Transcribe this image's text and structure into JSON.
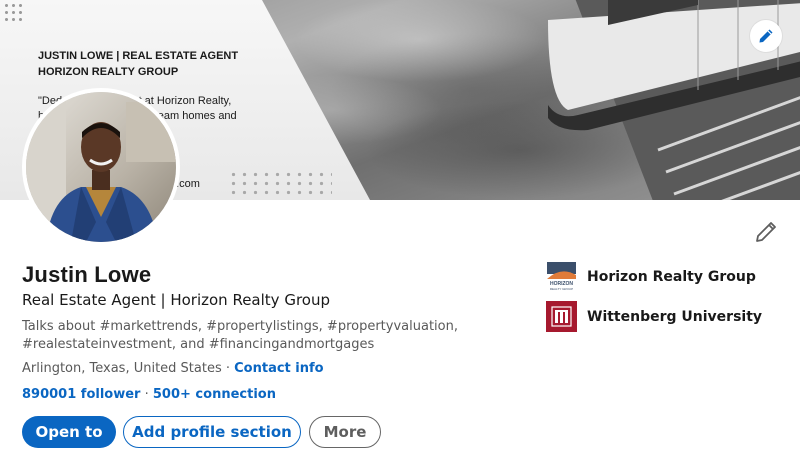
{
  "banner": {
    "title_line1": "JUSTIN LOWE | REAL ESTATE AGENT",
    "title_line2": "HORIZON REALTY GROUP",
    "quote_line1": "\"Ded",
    "quote_line1b": "agent at Horizon Realty,",
    "quote_line2a": "h",
    "quote_line2b": "ream homes and",
    "website_fragment": "p.com",
    "edit_icon": "pencil-icon"
  },
  "profile": {
    "name": "Justin Lowe",
    "headline": "Real Estate Agent | Horizon Realty Group",
    "talks_about": "Talks about #markettrends, #propertylistings, #propertyvaluation, #realestateinvestment, and #financingandmortgages",
    "location": "Arlington, Texas, United States · ",
    "contact_info": "Contact info",
    "followers": "890001 follower",
    "separator": " · ",
    "connections": "500+ connection"
  },
  "actions": {
    "open_to": "Open to",
    "add_section": "Add profile section",
    "more": "More"
  },
  "organizations": [
    {
      "name": "Horizon Realty Group",
      "logo": "horizon-realty-logo"
    },
    {
      "name": "Wittenberg University",
      "logo": "wittenberg-logo"
    }
  ],
  "colors": {
    "link_blue": "#0a66c2",
    "text_dark": "#191919",
    "text_muted": "#595959",
    "wittenberg_red": "#a6192e",
    "horizon_orange": "#e07b39"
  }
}
